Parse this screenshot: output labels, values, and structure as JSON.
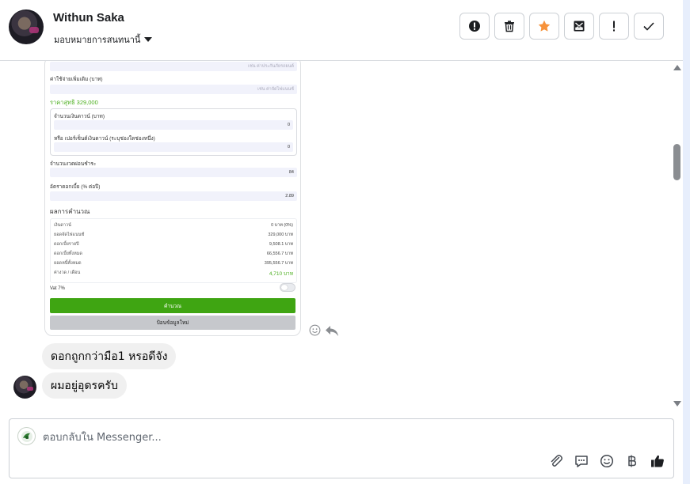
{
  "header": {
    "user_name": "Withun Saka",
    "assign_label": "มอบหมายการสนทนานี้"
  },
  "toolbar": {
    "buttons": [
      {
        "name": "mark-spam",
        "icon": "alert-circle-icon"
      },
      {
        "name": "delete",
        "icon": "trash-icon"
      },
      {
        "name": "star",
        "icon": "star-icon",
        "color": "#f7923a"
      },
      {
        "name": "mark-unread",
        "icon": "envelope-icon"
      },
      {
        "name": "follow-up",
        "icon": "exclamation-icon"
      },
      {
        "name": "done",
        "icon": "check-icon"
      }
    ]
  },
  "calculator": {
    "label_extra": "ค่าใช้จ่ายเพิ่มเติม (บาท)",
    "placeholder_top": "เช่น ค่าประกันภัยรถยนต์",
    "placeholder_extra": "เช่น ค่าจัดไฟแนนซ์",
    "net_price": "ราคาสุทธิ 329,000",
    "down_label": "จำนวนเงินดาวน์ (บาท)",
    "down_value": "0",
    "down_pct_label": "หรือ เปอร์เซ็นต์เงินดาวน์ (ระบุช่องใดช่องหนึ่ง)",
    "down_pct_value": "0",
    "installments_label": "จำนวนงวดผ่อนชำระ",
    "installments_value": "84",
    "interest_label": "อัตราดอกเบี้ย (% ต่อปี)",
    "interest_value": "2.89",
    "results_title": "ผลการคำนวณ",
    "results": [
      {
        "label": "เงินดาวน์",
        "value": "0 บาท (0%)"
      },
      {
        "label": "ยอดจัดไฟแนนซ์",
        "value": "329,000 บาท"
      },
      {
        "label": "ดอกเบี้ยรายปี",
        "value": "9,508.1 บาท"
      },
      {
        "label": "ดอกเบี้ยทั้งหมด",
        "value": "66,556.7 บาท"
      },
      {
        "label": "ยอดหนี้ทั้งหมด",
        "value": "395,556.7 บาท"
      },
      {
        "label": "ค่างวด / เดือน",
        "value": "4,710 บาท",
        "highlight": true
      }
    ],
    "vat_label": "Vat 7%",
    "calc_button": "คำนวณ",
    "reset_button": "ป้อนข้อมูลใหม่"
  },
  "messages": [
    {
      "text": "ดอกถูกกว่ามือ1 หรอดีจัง"
    },
    {
      "text": "ผมอยู่อุดรครับ"
    }
  ],
  "composer": {
    "placeholder": "ตอบกลับใน Messenger...",
    "tools": [
      "attachment-icon",
      "saved-reply-icon",
      "emoji-icon",
      "baht-icon",
      "like-icon"
    ]
  },
  "colors": {
    "accent_green": "#3fa512",
    "star": "#f7923a"
  }
}
